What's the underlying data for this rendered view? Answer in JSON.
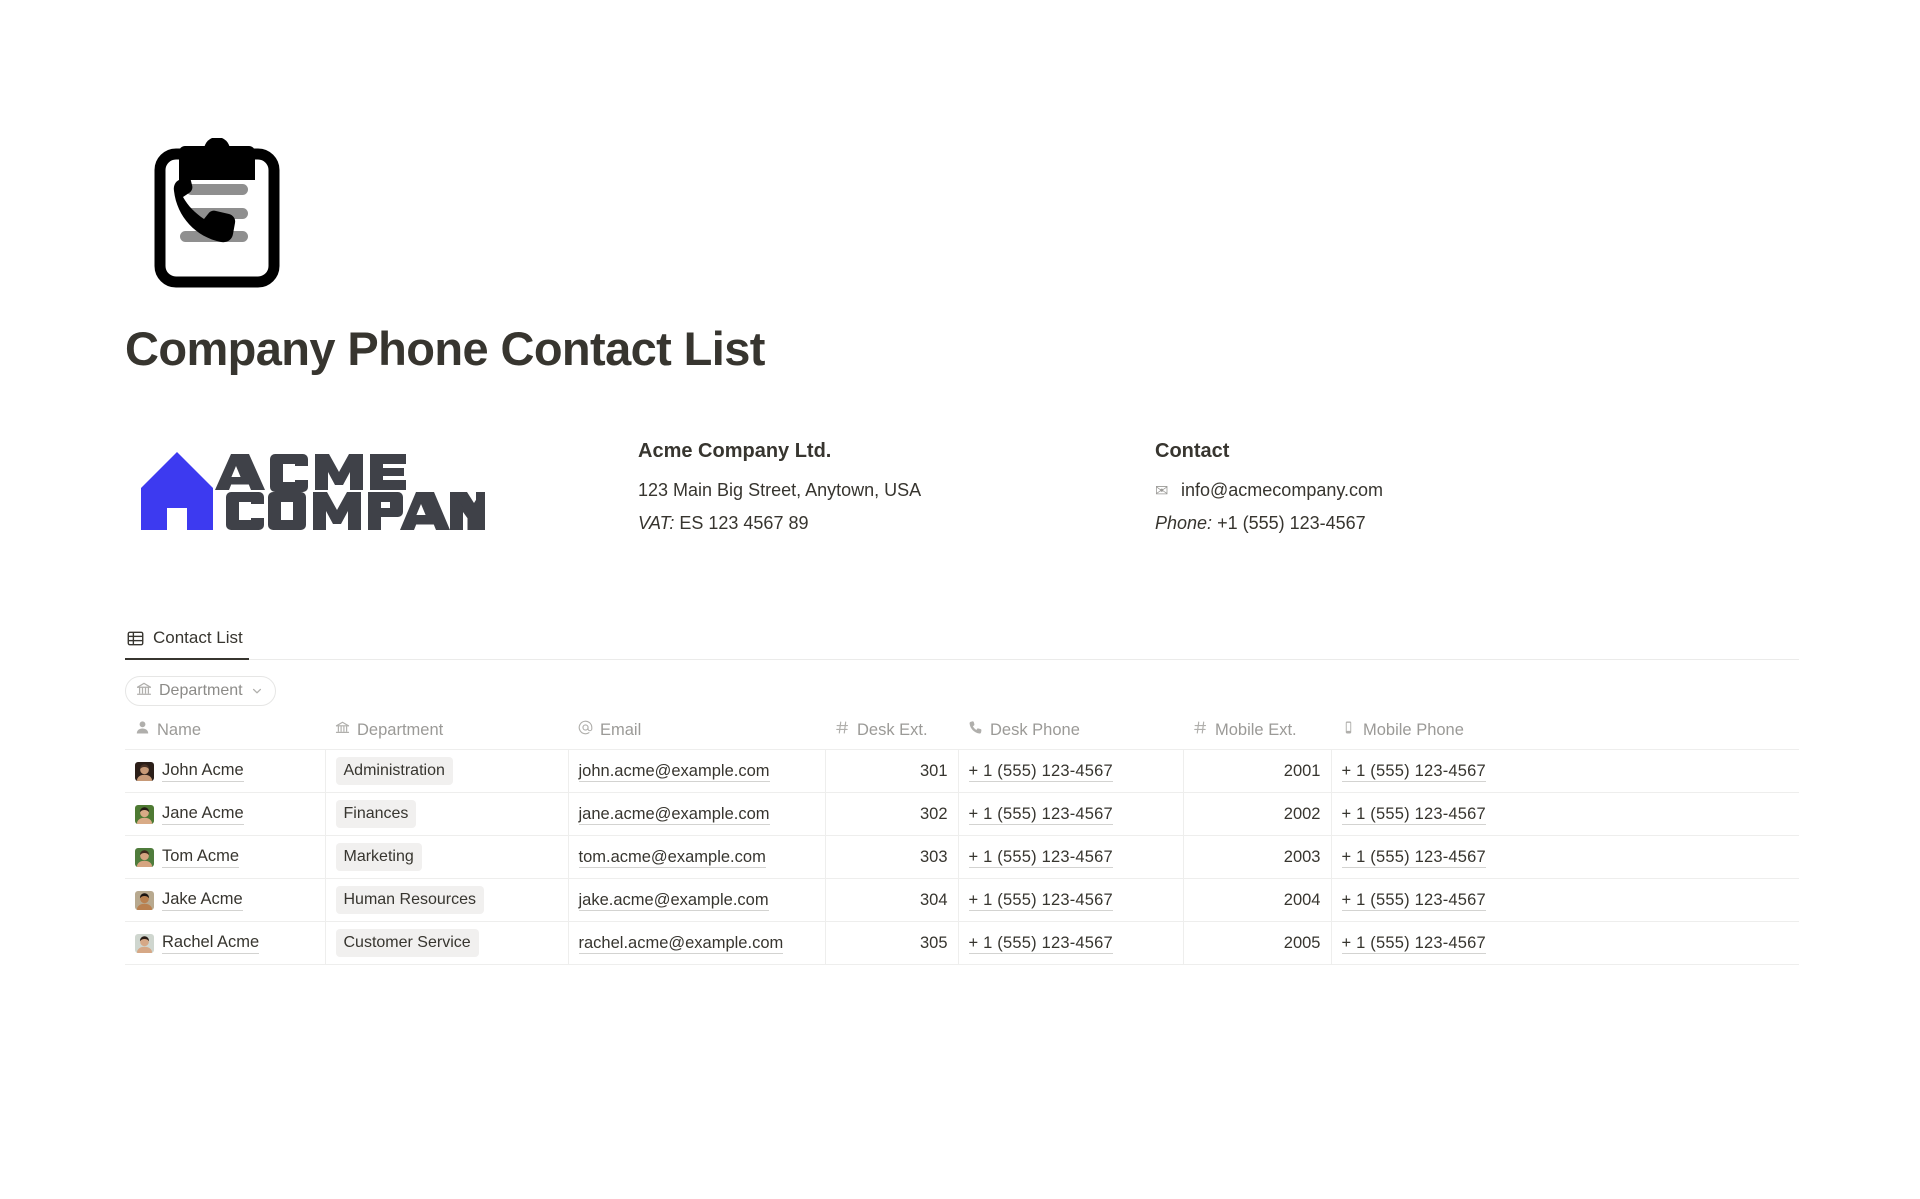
{
  "document": {
    "icon": "clipboard-phone-icon",
    "title": "Company Phone Contact List"
  },
  "company": {
    "logo_text_line1": "ACME",
    "logo_text_line2": "COMPANY",
    "logo_accent_color": "#3d3af0",
    "logo_text_color": "#3f4148",
    "heading": "Acme Company Ltd.",
    "address": "123 Main Big Street, Anytown, USA",
    "vat_label": "VAT:",
    "vat_value": "ES 123 4567 89"
  },
  "contact": {
    "heading": "Contact",
    "email_icon": "envelope-icon",
    "email": "info@acmecompany.com",
    "phone_label": "Phone:",
    "phone_value": "+1 (555) 123-4567"
  },
  "tabs": [
    {
      "label": "Contact List",
      "icon": "table-icon",
      "active": true
    }
  ],
  "filters": [
    {
      "label": "Department",
      "icon": "bank-icon",
      "chevron": "chevron-down-icon"
    }
  ],
  "table": {
    "columns": [
      {
        "key": "name",
        "label": "Name",
        "icon": "person-icon",
        "align": "left"
      },
      {
        "key": "dept",
        "label": "Department",
        "icon": "bank-icon",
        "align": "left"
      },
      {
        "key": "email",
        "label": "Email",
        "icon": "at-icon",
        "align": "left"
      },
      {
        "key": "dext",
        "label": "Desk Ext.",
        "icon": "hash-icon",
        "align": "right"
      },
      {
        "key": "dphone",
        "label": "Desk Phone",
        "icon": "phone-icon",
        "align": "left"
      },
      {
        "key": "mext",
        "label": "Mobile Ext.",
        "icon": "hash-icon",
        "align": "right"
      },
      {
        "key": "mphone",
        "label": "Mobile Phone",
        "icon": "smartphone-icon",
        "align": "left"
      }
    ],
    "rows": [
      {
        "name": "John Acme",
        "avatar": "avatar-john",
        "dept": "Administration",
        "email": "john.acme@example.com",
        "dext": "301",
        "dphone": "+ 1 (555) 123-4567",
        "mext": "2001",
        "mphone": "+ 1 (555) 123-4567"
      },
      {
        "name": "Jane Acme",
        "avatar": "avatar-jane",
        "dept": "Finances",
        "email": "jane.acme@example.com",
        "dext": "302",
        "dphone": "+ 1 (555) 123-4567",
        "mext": "2002",
        "mphone": "+ 1 (555) 123-4567"
      },
      {
        "name": "Tom Acme",
        "avatar": "avatar-tom",
        "dept": "Marketing",
        "email": "tom.acme@example.com",
        "dext": "303",
        "dphone": "+ 1 (555) 123-4567",
        "mext": "2003",
        "mphone": "+ 1 (555) 123-4567"
      },
      {
        "name": "Jake Acme",
        "avatar": "avatar-jake",
        "dept": "Human Resources",
        "email": "jake.acme@example.com",
        "dext": "304",
        "dphone": "+ 1 (555) 123-4567",
        "mext": "2004",
        "mphone": "+ 1 (555) 123-4567"
      },
      {
        "name": "Rachel Acme",
        "avatar": "avatar-rachel",
        "dept": "Customer Service",
        "email": "rachel.acme@example.com",
        "dext": "305",
        "dphone": "+ 1 (555) 123-4567",
        "mext": "2005",
        "mphone": "+ 1 (555) 123-4567"
      }
    ]
  }
}
